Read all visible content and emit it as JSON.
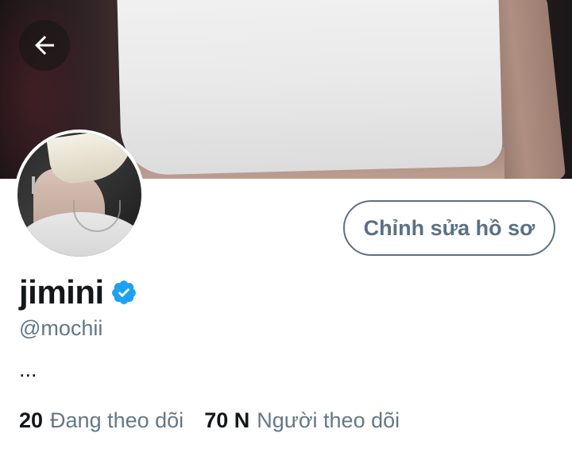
{
  "profile": {
    "display_name": "jimini",
    "handle": "@mochii",
    "bio": "...",
    "verified": true,
    "edit_button_label": "Chỉnh sửa hồ sơ"
  },
  "stats": {
    "following_count": "20",
    "following_label": "Đang theo dõi",
    "followers_count": "70 N",
    "followers_label": "Người theo dõi"
  },
  "icons": {
    "back": "arrow-left-icon",
    "verified": "verified-badge-icon"
  },
  "colors": {
    "accent": "#1da1f2",
    "secondary_text": "#657786",
    "border": "#5b7083"
  }
}
